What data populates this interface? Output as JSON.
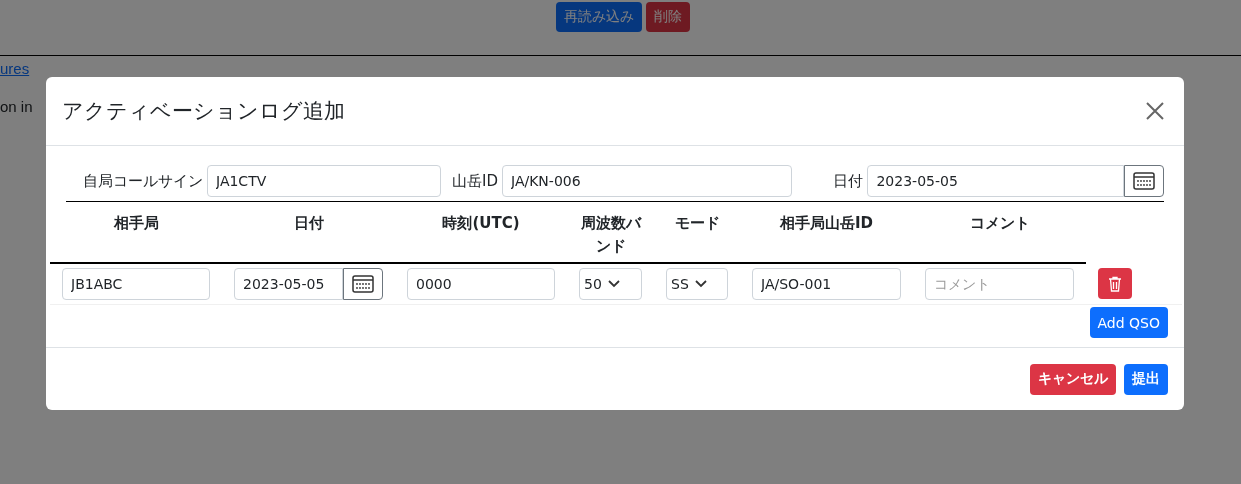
{
  "page": {
    "buttons": [
      {
        "label": "再読み込み",
        "kind": "primary"
      },
      {
        "label": "削除",
        "kind": "danger"
      }
    ],
    "footer": {
      "link": "ures",
      "line_2": "on in"
    }
  },
  "modal": {
    "title": "アクティベーションログ追加",
    "fields": [
      {
        "label": "自局コールサイン",
        "value": "JA1CTV",
        "kind": "text"
      },
      {
        "label": "山岳ID",
        "value": "JA/KN-006",
        "kind": "text"
      },
      {
        "label": "日付",
        "value": "2023-05-05",
        "kind": "date"
      }
    ],
    "table": {
      "columns": [
        "相手局",
        "日付",
        "時刻(UTC)",
        "周波数バンド",
        "モード",
        "相手局山岳ID",
        "コメント"
      ],
      "rows": [
        {
          "cells": [
            {
              "kind": "text",
              "value": "JB1ABC"
            },
            {
              "kind": "date",
              "value": "2023-05-05"
            },
            {
              "kind": "text",
              "value": "0000"
            },
            {
              "kind": "select",
              "value": "50"
            },
            {
              "kind": "select",
              "value": "SS"
            },
            {
              "kind": "text",
              "value": "JA/SO-001"
            },
            {
              "kind": "text",
              "placeholder": "コメント"
            }
          ]
        }
      ]
    },
    "add_button": "Add QSO",
    "footer_buttons": [
      {
        "label": "キャンセル",
        "kind": "danger"
      },
      {
        "label": "提出",
        "kind": "primary"
      }
    ]
  }
}
